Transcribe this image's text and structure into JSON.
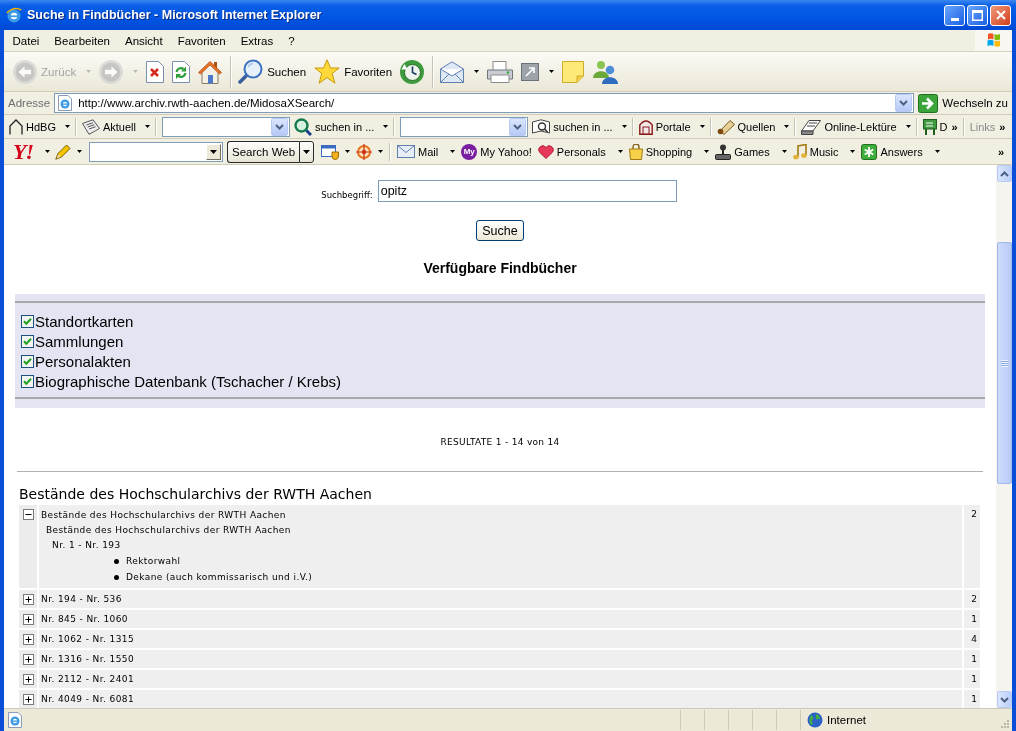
{
  "window": {
    "title": "Suche in Findbücher - Microsoft Internet Explorer"
  },
  "menu": [
    {
      "label": "Datei"
    },
    {
      "label": "Bearbeiten"
    },
    {
      "label": "Ansicht"
    },
    {
      "label": "Favoriten"
    },
    {
      "label": "Extras"
    },
    {
      "label": "?"
    }
  ],
  "toolbar": [
    {
      "kind": "button",
      "label": "Zurück",
      "disabled": true,
      "dropdown": true
    },
    {
      "kind": "button",
      "disabled": true,
      "dropdown": true
    },
    {
      "kind": "button",
      "disabled": false
    },
    {
      "kind": "button",
      "disabled": false
    },
    {
      "kind": "button",
      "disabled": false
    },
    {
      "kind": "separator"
    },
    {
      "kind": "button",
      "label": "Suchen",
      "disabled": false
    },
    {
      "kind": "button",
      "label": "Favoriten",
      "disabled": false
    },
    {
      "kind": "button",
      "disabled": false
    },
    {
      "kind": "separator"
    },
    {
      "kind": "button",
      "disabled": false,
      "dropdown": true
    },
    {
      "kind": "button",
      "disabled": false
    },
    {
      "kind": "button",
      "disabled": false,
      "dropdown": true
    },
    {
      "kind": "button",
      "disabled": false
    },
    {
      "kind": "button",
      "disabled": false
    }
  ],
  "address": {
    "label": "Adresse",
    "url": "http://www.archiv.rwth-aachen.de/MidosaXSearch/",
    "go": "Wechseln zu"
  },
  "links_toolbar": [
    {
      "kind": "button",
      "label": "HdBG",
      "dropdown": true
    },
    {
      "kind": "separator"
    },
    {
      "kind": "button",
      "label": "Aktuell",
      "dropdown": true
    },
    {
      "kind": "separator"
    },
    {
      "kind": "combo"
    },
    {
      "kind": "button",
      "label": "suchen in ...",
      "dropdown": true
    },
    {
      "kind": "separator"
    },
    {
      "kind": "combo"
    },
    {
      "kind": "button",
      "label": "suchen in ...",
      "dropdown": true
    },
    {
      "kind": "separator"
    },
    {
      "kind": "button",
      "label": "Portale",
      "dropdown": true
    },
    {
      "kind": "separator"
    },
    {
      "kind": "button",
      "label": "Quellen",
      "dropdown": true
    },
    {
      "kind": "separator"
    },
    {
      "kind": "button",
      "label": "Online-Lektüre",
      "dropdown": true
    },
    {
      "kind": "separator"
    },
    {
      "kind": "button",
      "label": "D"
    },
    {
      "kind": "chevron",
      "label": "»"
    },
    {
      "kind": "separator"
    },
    {
      "kind": "band",
      "label": "Links"
    },
    {
      "kind": "chevron",
      "label": "»"
    }
  ],
  "yahoo_toolbar": [
    {
      "kind": "logo",
      "label": "Y!",
      "dropdown": true
    },
    {
      "kind": "button",
      "dropdown": true
    },
    {
      "kind": "combo"
    },
    {
      "kind": "split",
      "label": "Search Web"
    },
    {
      "kind": "button",
      "dropdown": true
    },
    {
      "kind": "button",
      "dropdown": true
    },
    {
      "kind": "separator"
    },
    {
      "kind": "button",
      "label": "Mail",
      "dropdown": true
    },
    {
      "kind": "badge",
      "badge": "My",
      "label": "My Yahoo!"
    },
    {
      "kind": "button",
      "label": "Personals",
      "dropdown": true
    },
    {
      "kind": "button",
      "label": "Shopping",
      "dropdown": true
    },
    {
      "kind": "button",
      "label": "Games",
      "dropdown": true
    },
    {
      "kind": "button",
      "label": "Music",
      "dropdown": true
    },
    {
      "kind": "button",
      "label": "Answers",
      "dropdown": true
    },
    {
      "kind": "chevron",
      "label": "»"
    }
  ],
  "search_form": {
    "label": "Suchbegriff:",
    "value": "opitz",
    "button": "Suche"
  },
  "catalogs": {
    "title": "Verfügbare Findbücher",
    "items": [
      {
        "label": "Standortkarten",
        "checked": true
      },
      {
        "label": "Sammlungen",
        "checked": true
      },
      {
        "label": "Personalakten",
        "checked": true
      },
      {
        "label": "Biographische Datenbank (Tschacher / Krebs)",
        "checked": true
      }
    ]
  },
  "results": {
    "summary": "RESULTATE 1 - 14 von 14",
    "heading": "Bestände des Hochschularchivs der RWTH Aachen",
    "rows": [
      {
        "label": "Bestände des Hochschularchivs der RWTH Aachen",
        "count": "2",
        "expanded": true,
        "children": [
          {
            "label": "Bestände des Hochschularchivs der RWTH Aachen",
            "children": [
              {
                "label": "Nr. 1 - Nr. 193",
                "children": [
                  {
                    "label": "Rektorwahl"
                  },
                  {
                    "label": "Dekane (auch kommissarisch und i.V.)"
                  }
                ]
              }
            ]
          }
        ]
      },
      {
        "label": "Nr. 194 - Nr. 536",
        "count": "2",
        "expanded": false
      },
      {
        "label": "Nr. 845 - Nr. 1060",
        "count": "1",
        "expanded": false
      },
      {
        "label": "Nr. 1062 - Nr. 1315",
        "count": "4",
        "expanded": false
      },
      {
        "label": "Nr. 1316 - Nr. 1550",
        "count": "1",
        "expanded": false
      },
      {
        "label": "Nr. 2112 - Nr. 2401",
        "count": "1",
        "expanded": false
      },
      {
        "label": "Nr. 4049 - Nr. 6081",
        "count": "1",
        "expanded": false
      }
    ]
  },
  "status_bar": {
    "zone": "Internet"
  }
}
